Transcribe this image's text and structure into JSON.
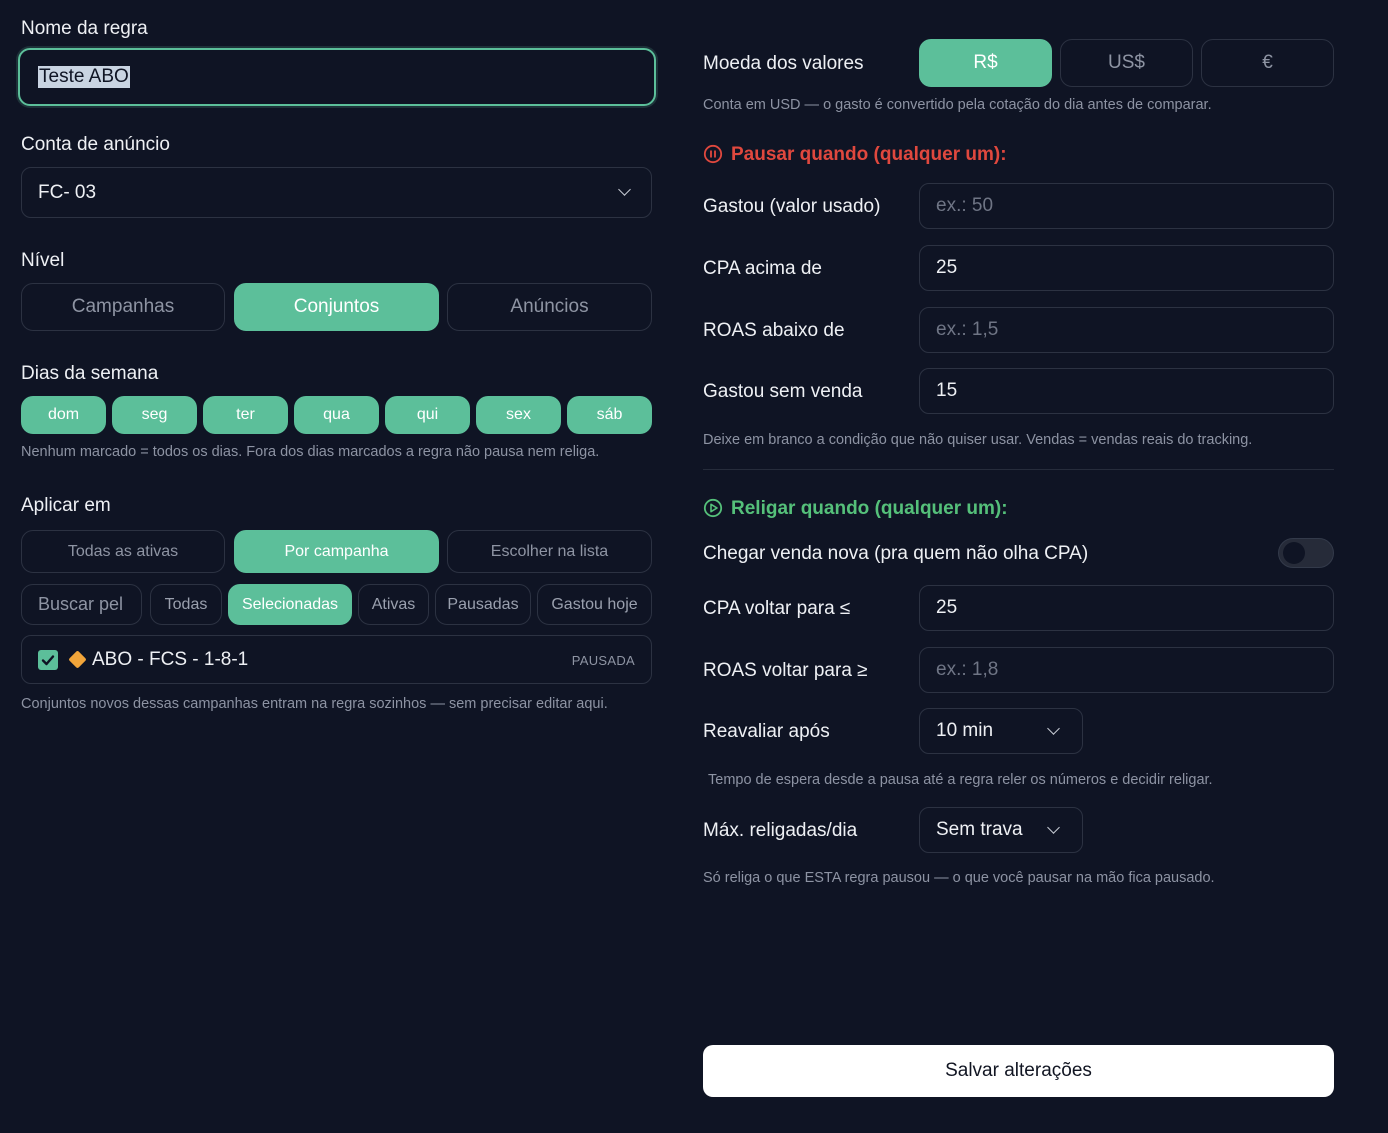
{
  "left": {
    "rule_name_label": "Nome da regra",
    "rule_name_value": "Teste ABO",
    "ad_account_label": "Conta de anúncio",
    "ad_account_value": "FC- 03",
    "level_label": "Nível",
    "level_options": [
      "Campanhas",
      "Conjuntos",
      "Anúncios"
    ],
    "weekdays_label": "Dias da semana",
    "weekdays": [
      "dom",
      "seg",
      "ter",
      "qua",
      "qui",
      "sex",
      "sáb"
    ],
    "weekdays_hint": "Nenhum marcado = todos os dias. Fora dos dias marcados a regra não pausa nem religa.",
    "apply_label": "Aplicar em",
    "apply_options": [
      "Todas as ativas",
      "Por campanha",
      "Escolher na lista"
    ],
    "search_placeholder": "Buscar pel",
    "filters": [
      "Todas",
      "Selecionadas",
      "Ativas",
      "Pausadas",
      "Gastou hoje"
    ],
    "campaign_item": {
      "name": "ABO - FCS - 1-8-1",
      "status": "PAUSADA"
    },
    "campaign_hint": "Conjuntos novos dessas campanhas entram na regra sozinhos — sem precisar editar aqui."
  },
  "right": {
    "currency_label": "Moeda dos valores",
    "currencies": [
      "R$",
      "US$",
      "€"
    ],
    "currency_hint": "Conta em USD — o gasto é convertido pela cotação do dia antes de comparar.",
    "pause_title": "Pausar quando (qualquer um):",
    "pause_rows": {
      "spent_label": "Gastou (valor usado)",
      "spent_placeholder": "ex.: 50",
      "cpa_label": "CPA acima de",
      "cpa_value": "25",
      "roas_label": "ROAS abaixo de",
      "roas_placeholder": "ex.: 1,5",
      "nosale_label": "Gastou sem venda",
      "nosale_value": "15"
    },
    "pause_hint": "Deixe em branco a condição que não quiser usar. Vendas = vendas reais do tracking.",
    "resume_title": "Religar quando (qualquer um):",
    "new_sale_label": "Chegar venda nova (pra quem não olha CPA)",
    "cpa_back_label": "CPA voltar para ≤",
    "cpa_back_value": "25",
    "roas_back_label": "ROAS voltar para ≥",
    "roas_back_placeholder": "ex.: 1,8",
    "reevaluate_label": "Reavaliar após",
    "reevaluate_value": "10 min",
    "reevaluate_hint": "Tempo de espera desde a pausa até a regra reler os números e decidir religar.",
    "max_label": "Máx. religadas/dia",
    "max_value": "Sem trava",
    "max_hint": "Só religa o que ESTA regra pausou — o que você pausar na mão fica pausado.",
    "save_label": "Salvar alterações"
  },
  "colors": {
    "accent": "#5cbf9a",
    "pause": "#e0483e",
    "resume": "#55c07a",
    "background": "#0f1424"
  }
}
